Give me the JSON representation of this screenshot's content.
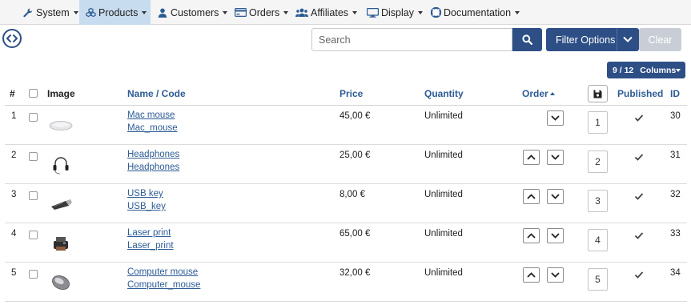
{
  "menu": {
    "items": [
      {
        "label": "System",
        "icon": "wrench-icon"
      },
      {
        "label": "Products",
        "icon": "cubes-icon",
        "active": true
      },
      {
        "label": "Customers",
        "icon": "user-icon"
      },
      {
        "label": "Orders",
        "icon": "credit-card-icon"
      },
      {
        "label": "Affiliates",
        "icon": "users-icon"
      },
      {
        "label": "Display",
        "icon": "monitor-icon"
      },
      {
        "label": "Documentation",
        "icon": "lifebuoy-icon"
      }
    ]
  },
  "toolbar": {
    "search_placeholder": "Search",
    "filter_label": "Filter Options",
    "clear_label": "Clear",
    "columns_count": "9 / 12",
    "columns_label": "Columns"
  },
  "table": {
    "headers": {
      "num": "#",
      "image": "Image",
      "name": "Name / Code",
      "price": "Price",
      "quantity": "Quantity",
      "order": "Order",
      "published": "Published",
      "id": "ID"
    },
    "rows": [
      {
        "num": "1",
        "name": "Mac mouse",
        "code": "Mac_mouse",
        "price": "45,00 €",
        "quantity": "Unlimited",
        "order": "1",
        "id": "30",
        "thumb": "mouse-thumb"
      },
      {
        "num": "2",
        "name": "Headphones",
        "code": "Headphones",
        "price": "25,00 €",
        "quantity": "Unlimited",
        "order": "2",
        "id": "31",
        "thumb": "headphones-thumb"
      },
      {
        "num": "3",
        "name": "USB key",
        "code": "USB_key",
        "price": "8,00 €",
        "quantity": "Unlimited",
        "order": "3",
        "id": "32",
        "thumb": "usb-key-thumb"
      },
      {
        "num": "4",
        "name": "Laser print",
        "code": "Laser_print",
        "price": "65,00 €",
        "quantity": "Unlimited",
        "order": "4",
        "id": "33",
        "thumb": "printer-thumb"
      },
      {
        "num": "5",
        "name": "Computer mouse",
        "code": "Computer_mouse",
        "price": "32,00 €",
        "quantity": "Unlimited",
        "order": "5",
        "id": "34",
        "thumb": "computer-mouse-thumb"
      }
    ]
  },
  "colors": {
    "primary": "#2d4f86",
    "link": "#2d5c96",
    "menu_active": "#c8dcef",
    "menubar_bg": "#f5f5f5",
    "clear_disabled": "#c9ced6"
  }
}
